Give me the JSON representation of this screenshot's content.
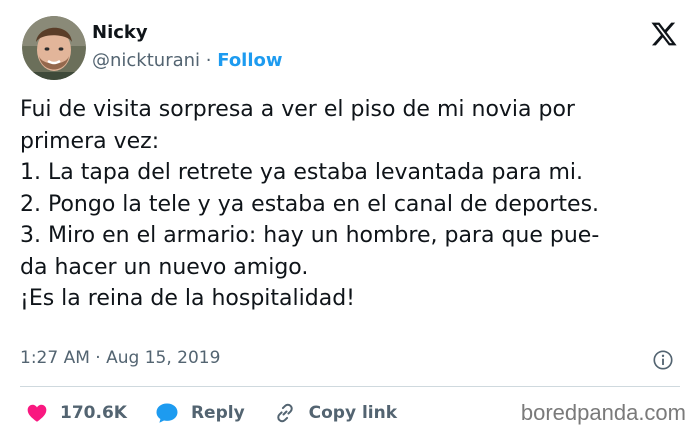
{
  "author": {
    "name": "Nicky",
    "handle": "@nickturani",
    "separator": "·",
    "follow_label": "Follow"
  },
  "tweet": {
    "lines": [
      "Fui de visita sorpresa  a ver el piso de mi novia por",
      "primera vez:",
      "1. La tapa del retrete ya estaba levantada para mi.",
      "2. Pongo la tele y ya estaba en el canal de deportes.",
      "3. Miro en el armario: hay un hombre, para que pue-",
      "da hacer un nuevo amigo.",
      "¡Es la reina de la hospitalidad!"
    ],
    "time": "1:27 AM",
    "meta_separator": "·",
    "date": "Aug 15, 2019"
  },
  "actions": {
    "likes_count": "170.6K",
    "reply_label": "Reply",
    "copy_link_label": "Copy link"
  },
  "watermark": "boredpanda.com",
  "icons": {
    "logo": "x-logo-icon",
    "info": "info-icon",
    "like": "heart-icon",
    "reply": "reply-bubble-icon",
    "copy": "link-icon"
  },
  "colors": {
    "text": "#0f1419",
    "secondary": "#536471",
    "accent": "#1d9bf0",
    "like": "#f91880",
    "divider": "#cfd9de"
  }
}
